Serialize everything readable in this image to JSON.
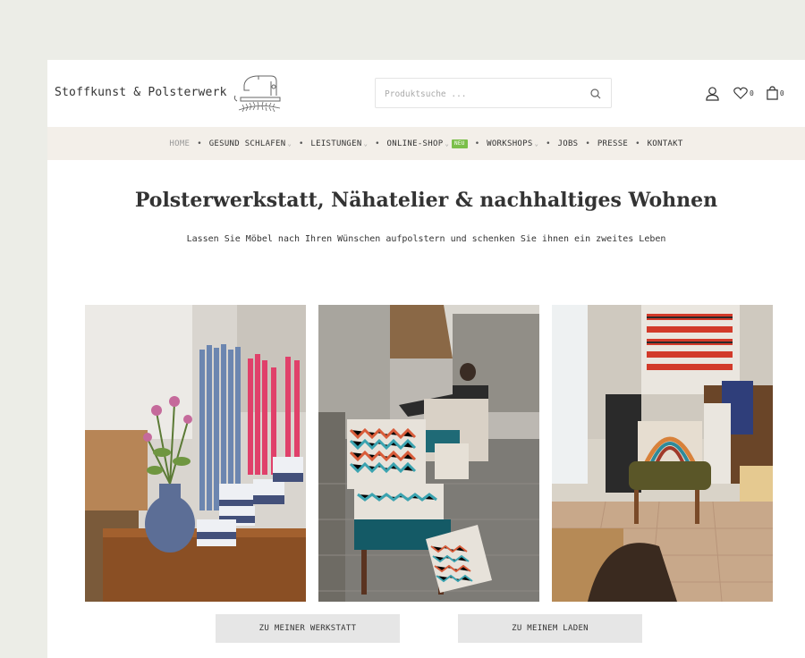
{
  "header": {
    "brand": "Stoffkunst & Polsterwerk",
    "search": {
      "placeholder": "Produktsuche ..."
    },
    "wishlist_count": "0",
    "cart_count": "0"
  },
  "nav": {
    "items": [
      {
        "label": "HOME"
      },
      {
        "label": "GESUND SCHLAFEN"
      },
      {
        "label": "LEISTUNGEN"
      },
      {
        "label": "ONLINE-SHOP",
        "badge": "NEU"
      },
      {
        "label": "WORKSHOPS"
      },
      {
        "label": "JOBS"
      },
      {
        "label": "PRESSE"
      },
      {
        "label": "KONTAKT"
      }
    ]
  },
  "hero": {
    "title": "Polsterwerkstatt, Nähatelier & nachhaltiges Wohnen",
    "subtitle": "Lassen Sie Möbel nach Ihren Wünschen aufpolstern und schenken Sie ihnen ein zweites Leben"
  },
  "buttons": {
    "werkstatt": "ZU MEINER WERKSTATT",
    "laden": "ZU MEINEM LADEN"
  },
  "icons": {
    "account": "user-icon",
    "wishlist": "heart-icon",
    "cart": "bag-icon",
    "search": "search-icon"
  },
  "colors": {
    "nav_bg": "#f3efe9",
    "button_bg": "#e6e6e6",
    "new_badge": "#7bbf4a"
  }
}
